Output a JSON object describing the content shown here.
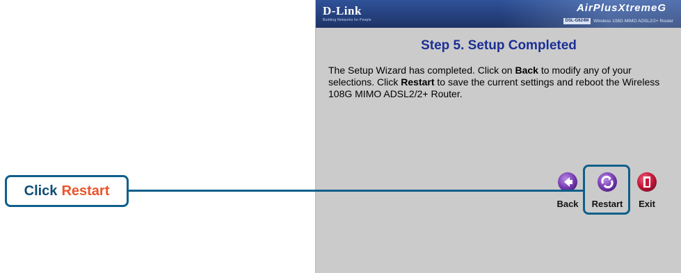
{
  "header": {
    "brand": "D-Link",
    "tagline": "Building Networks for People",
    "product_logo": "AirPlusXtremeG",
    "model_badge": "DSL-G624M",
    "model_text": "Wireless 108G MIMO ADSL2/2+ Router"
  },
  "wizard": {
    "title": "Step 5. Setup Completed",
    "desc_1": "The Setup Wizard has completed. Click on ",
    "desc_back": "Back",
    "desc_2": " to modify any of your selections. Click ",
    "desc_restart": "Restart",
    "desc_3": " to save the current settings and reboot the Wireless 108G MIMO ADSL2/2+ Router."
  },
  "nav": {
    "back_label": "Back",
    "restart_label": "Restart",
    "exit_label": "Exit",
    "back_icon": "arrow-left-icon",
    "restart_icon": "restart-icon",
    "exit_icon": "exit-door-icon"
  },
  "callout": {
    "prefix": "Click",
    "emphasis": "Restart",
    "emphasis_color": "#e9552b",
    "border_color": "#0e5f8a"
  },
  "colors": {
    "icon_purple": "#7b3fb5",
    "exit_red": "#c4183a",
    "title_blue": "#1c2f95"
  }
}
